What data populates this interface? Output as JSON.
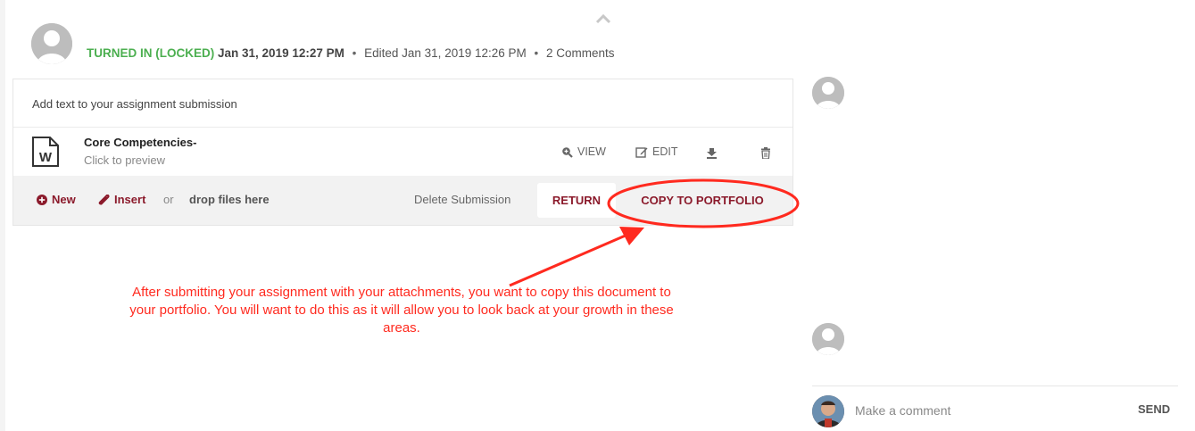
{
  "submission": {
    "status": "TURNED IN (LOCKED)",
    "turned_in_date": "Jan 31, 2019 12:27 PM",
    "edited": "Edited Jan 31, 2019 12:26 PM",
    "comments_count": "2 Comments",
    "separator": "•",
    "add_text_placeholder": "Add text to your assignment submission"
  },
  "attachment": {
    "name": "Core Competencies-",
    "subtitle": "Click to preview",
    "icon": "word-document-icon",
    "actions": {
      "view": "VIEW",
      "edit": "EDIT"
    }
  },
  "toolbar": {
    "new_label": "New",
    "insert_label": "Insert",
    "or_label": "or",
    "drop_label": "drop files here",
    "delete_label": "Delete Submission",
    "return_label": "RETURN",
    "copy_label": "COPY TO PORTFOLIO"
  },
  "annotation": {
    "text": "After submitting your assignment with your attachments, you want to copy this document to your portfolio. You will want to do this as it will allow you to look back at your growth in these areas.",
    "color": "#ff2a1f"
  },
  "comments": {
    "placeholder": "Make a comment",
    "send_label": "SEND"
  },
  "colors": {
    "status_green": "#4caf50",
    "accent_maroon": "#8b1a2b",
    "toolbar_bg": "#f2f2f2"
  }
}
